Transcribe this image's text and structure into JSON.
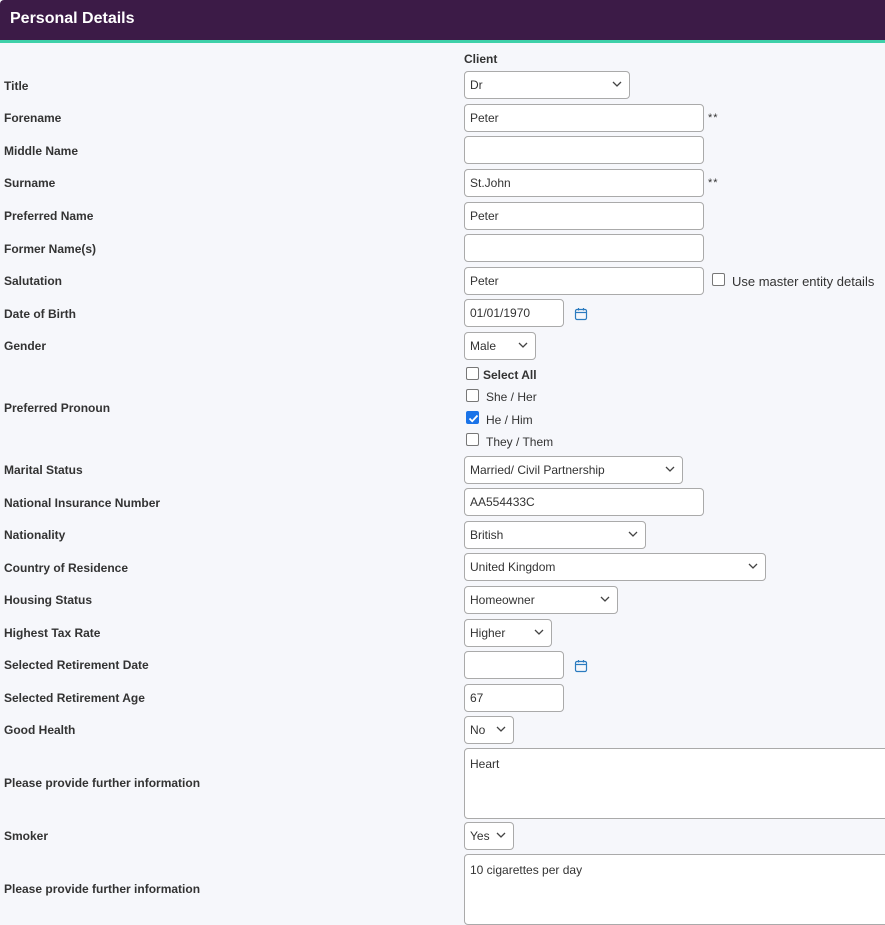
{
  "header": {
    "title": "Personal Details"
  },
  "column_header": "Client",
  "fields": {
    "title": {
      "label": "Title",
      "value": "Dr"
    },
    "forename": {
      "label": "Forename",
      "value": "Peter",
      "required_marker": "**"
    },
    "middle_name": {
      "label": "Middle Name",
      "value": ""
    },
    "surname": {
      "label": "Surname",
      "value": "St.John",
      "required_marker": "**"
    },
    "preferred_name": {
      "label": "Preferred Name",
      "value": "Peter"
    },
    "former_names": {
      "label": "Former Name(s)",
      "value": ""
    },
    "salutation": {
      "label": "Salutation",
      "value": "Peter",
      "checkbox_label": "Use master entity details",
      "checkbox_checked": false
    },
    "dob": {
      "label": "Date of Birth",
      "value": "01/01/1970"
    },
    "gender": {
      "label": "Gender",
      "value": "Male"
    },
    "pronoun": {
      "label": "Preferred Pronoun",
      "select_all_label": "Select All",
      "options": [
        {
          "label": "She / Her",
          "checked": false
        },
        {
          "label": "He / Him",
          "checked": true
        },
        {
          "label": "They / Them",
          "checked": false
        }
      ]
    },
    "marital_status": {
      "label": "Marital Status",
      "value": "Married/ Civil Partnership"
    },
    "ni_number": {
      "label": "National Insurance Number",
      "value": "AA554433C"
    },
    "nationality": {
      "label": "Nationality",
      "value": "British"
    },
    "country": {
      "label": "Country of Residence",
      "value": "United Kingdom"
    },
    "housing": {
      "label": "Housing Status",
      "value": "Homeowner"
    },
    "tax_rate": {
      "label": "Highest Tax Rate",
      "value": "Higher"
    },
    "retirement_date": {
      "label": "Selected Retirement Date",
      "value": ""
    },
    "retirement_age": {
      "label": "Selected Retirement Age",
      "value": "67"
    },
    "good_health": {
      "label": "Good Health",
      "value": "No"
    },
    "health_info": {
      "label": "Please provide further information",
      "value": "Heart"
    },
    "smoker": {
      "label": "Smoker",
      "value": "Yes"
    },
    "smoker_info": {
      "label": "Please provide further information",
      "value": "10 cigarettes per day"
    }
  },
  "colors": {
    "header_bg": "#3c1b47",
    "header_accent": "#3fd0a9",
    "checkbox_checked": "#1a73e8",
    "calendar_icon": "#2b7bbf"
  }
}
